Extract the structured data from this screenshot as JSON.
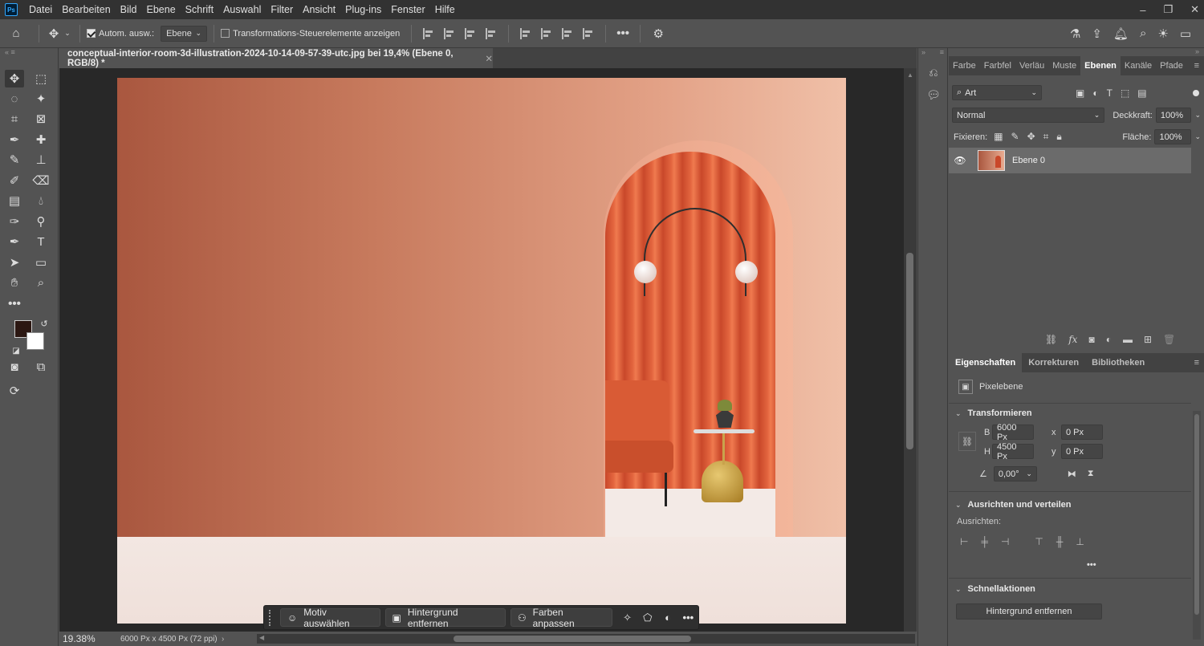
{
  "menu": {
    "items": [
      "Datei",
      "Bearbeiten",
      "Bild",
      "Ebene",
      "Schrift",
      "Auswahl",
      "Filter",
      "Ansicht",
      "Plug-ins",
      "Fenster",
      "Hilfe"
    ],
    "logo": "Ps"
  },
  "options": {
    "auto_select_label": "Autom. ausw.:",
    "auto_select_checked": true,
    "auto_select_target": "Ebene",
    "transform_controls_label": "Transformations-Steuerelemente anzeigen",
    "transform_controls_checked": false
  },
  "document": {
    "tab_title": "conceptual-interior-room-3d-illustration-2024-10-14-09-57-39-utc.jpg bei 19,4% (Ebene 0, RGB/8) *",
    "zoom": "19.38%",
    "info": "6000 Px x 4500 Px (72 ppi)"
  },
  "context_bar": {
    "select_subject": "Motiv auswählen",
    "remove_bg": "Hintergrund entfernen",
    "adjust_colors": "Farben anpassen"
  },
  "panel_tabs": [
    "Farbe",
    "Farbfel",
    "Verläu",
    "Muste",
    "Ebenen",
    "Kanäle",
    "Pfade"
  ],
  "layers": {
    "filter_kind": "Art",
    "blend_mode": "Normal",
    "opacity_label": "Deckkraft:",
    "opacity_value": "100%",
    "lock_label": "Fixieren:",
    "fill_label": "Fläche:",
    "fill_value": "100%",
    "items": [
      {
        "name": "Ebene 0",
        "visible": true
      }
    ]
  },
  "properties": {
    "tabs": [
      "Eigenschaften",
      "Korrekturen",
      "Bibliotheken"
    ],
    "layer_type": "Pixelebene",
    "transform_title": "Transformieren",
    "w_label": "B",
    "w_value": "6000 Px",
    "h_label": "H",
    "h_value": "4500 Px",
    "x_label": "x",
    "x_value": "0 Px",
    "y_label": "y",
    "y_value": "0 Px",
    "angle_value": "0,00°",
    "align_title": "Ausrichten und verteilen",
    "align_label": "Ausrichten:",
    "quick_actions_title": "Schnellaktionen",
    "quick_action_button": "Hintergrund entfernen"
  },
  "colors": {
    "foreground": "#2b1712",
    "background": "#ffffff",
    "accent": "#31a8ff"
  }
}
